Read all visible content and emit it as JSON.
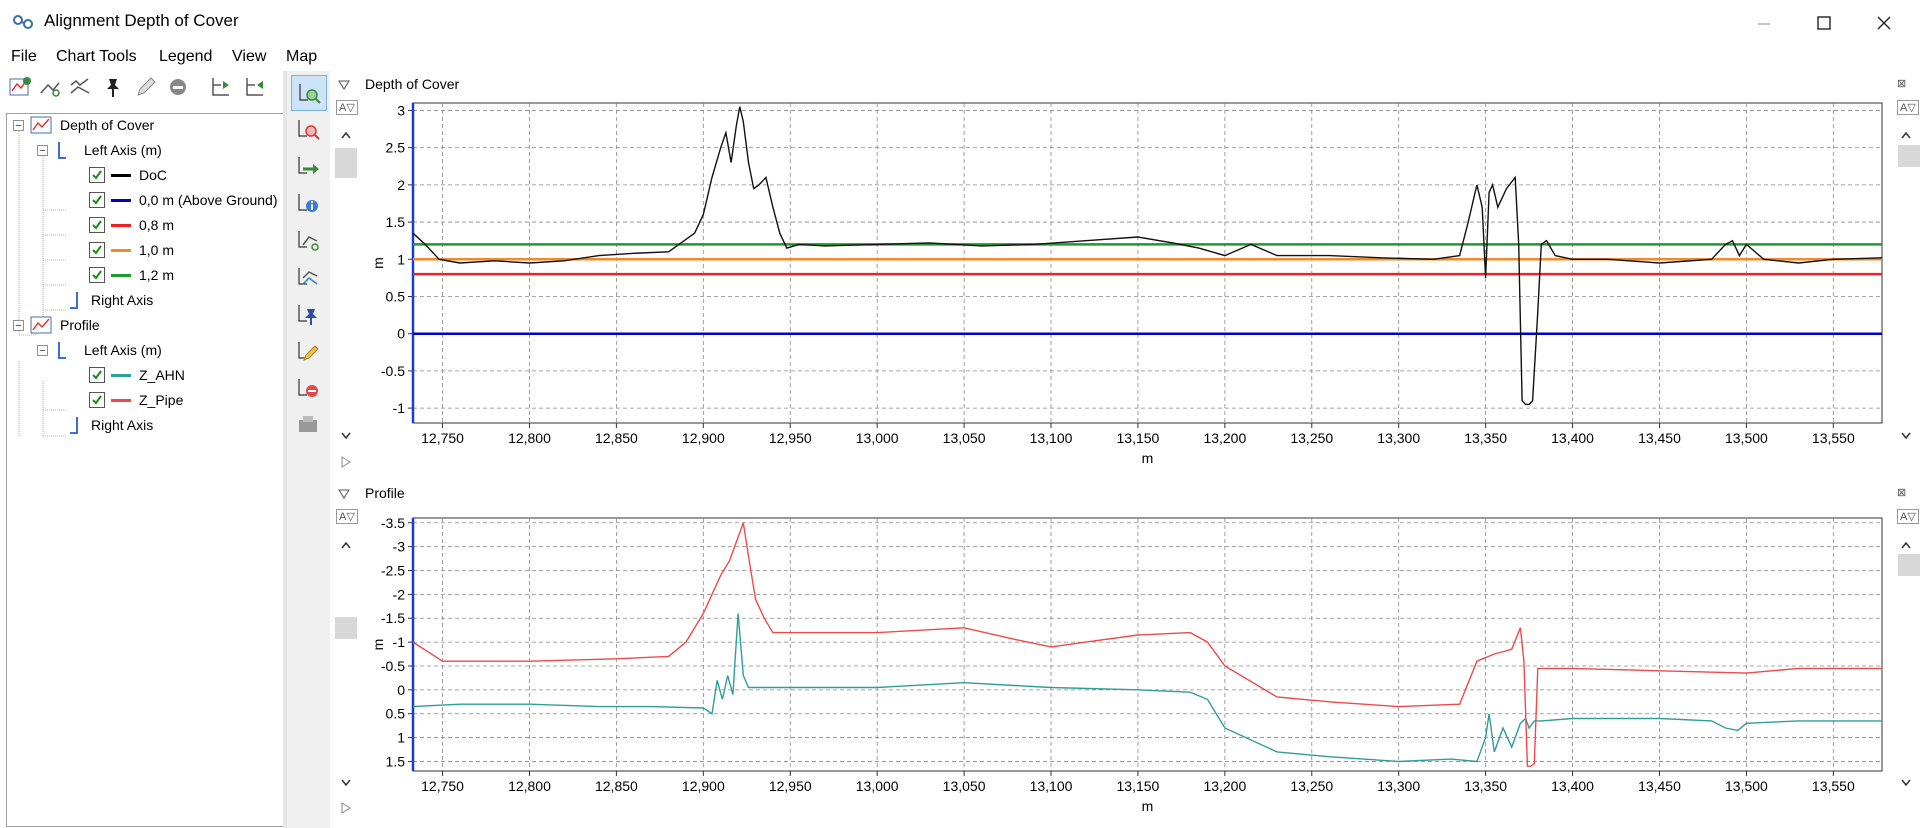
{
  "window": {
    "title": "Alignment Depth of Cover"
  },
  "menu": [
    "File",
    "Chart Tools",
    "Legend",
    "View",
    "Map"
  ],
  "tree": [
    {
      "label": "Depth of Cover",
      "level": 0
    },
    {
      "label": "Left Axis (m)",
      "level": 1
    },
    {
      "label": "DoC",
      "level": 2,
      "checked": true,
      "color": "#000000"
    },
    {
      "label": "0,0 m (Above Ground)",
      "level": 2,
      "checked": true,
      "color": "#0000cc"
    },
    {
      "label": "0,8 m",
      "level": 2,
      "checked": true,
      "color": "#ee2222"
    },
    {
      "label": "1,0 m",
      "level": 2,
      "checked": true,
      "color": "#f08a2a"
    },
    {
      "label": "1,2 m",
      "level": 2,
      "checked": true,
      "color": "#1e9a2a"
    },
    {
      "label": "Right Axis",
      "level": 1
    },
    {
      "label": "Profile",
      "level": 0
    },
    {
      "label": "Left Axis (m)",
      "level": 1
    },
    {
      "label": "Z_AHN",
      "level": 2,
      "checked": true,
      "color": "#2e9e9a"
    },
    {
      "label": "Z_Pipe",
      "level": 2,
      "checked": true,
      "color": "#ee4a4a"
    },
    {
      "label": "Right Axis",
      "level": 1
    }
  ],
  "charts": {
    "doc": {
      "title": "Depth of Cover",
      "ylabel": "m",
      "xlabel": "m",
      "resize_label": "A▽"
    },
    "profile": {
      "title": "Profile",
      "ylabel": "m",
      "xlabel": "m",
      "resize_label": "A▽"
    }
  },
  "chart_data": [
    {
      "type": "line",
      "title": "Depth of Cover",
      "xlabel": "m",
      "ylabel": "m",
      "xlim": [
        12733,
        13578
      ],
      "ylim": [
        3.1,
        -1.2
      ],
      "y_inverted": true,
      "xticks": [
        "12,750",
        "12,800",
        "12,850",
        "12,900",
        "12,950",
        "13,000",
        "13,050",
        "13,100",
        "13,150",
        "13,200",
        "13,250",
        "13,300",
        "13,350",
        "13,400",
        "13,450",
        "13,500",
        "13,550"
      ],
      "yticks": [
        "-1",
        "-0.5",
        "0",
        "0.5",
        "1",
        "1.5",
        "2",
        "2.5",
        "3"
      ],
      "grid": true,
      "hlines": [
        {
          "name": "0,0 m (Above Ground)",
          "value": 0.0,
          "color": "#0000cc"
        },
        {
          "name": "0,8 m",
          "value": 0.8,
          "color": "#ee2222"
        },
        {
          "name": "1,0 m",
          "value": 1.0,
          "color": "#f08a2a"
        },
        {
          "name": "1,2 m",
          "value": 1.2,
          "color": "#1e9a2a"
        }
      ],
      "series": [
        {
          "name": "DoC",
          "color": "#111111",
          "x": [
            12733,
            12740,
            12748,
            12760,
            12780,
            12800,
            12820,
            12840,
            12860,
            12880,
            12895,
            12900,
            12905,
            12910,
            12913,
            12916,
            12919,
            12921,
            12923,
            12926,
            12929,
            12932,
            12936,
            12940,
            12944,
            12948,
            12955,
            12970,
            13000,
            13030,
            13060,
            13090,
            13120,
            13150,
            13170,
            13185,
            13200,
            13215,
            13230,
            13260,
            13290,
            13320,
            13335,
            13340,
            13345,
            13348,
            13350,
            13352,
            13354,
            13357,
            13362,
            13367,
            13369,
            13371,
            13373,
            13375,
            13377,
            13380,
            13382,
            13385,
            13390,
            13400,
            13420,
            13450,
            13480,
            13488,
            13492,
            13496,
            13500,
            13510,
            13530,
            13550,
            13578
          ],
          "y": [
            1.35,
            1.2,
            1.0,
            0.95,
            0.98,
            0.95,
            0.98,
            1.05,
            1.08,
            1.1,
            1.35,
            1.6,
            2.1,
            2.5,
            2.7,
            2.3,
            2.8,
            3.05,
            2.85,
            2.3,
            1.95,
            2.0,
            2.1,
            1.7,
            1.35,
            1.15,
            1.2,
            1.18,
            1.2,
            1.22,
            1.18,
            1.2,
            1.25,
            1.3,
            1.22,
            1.15,
            1.05,
            1.2,
            1.05,
            1.05,
            1.02,
            1.0,
            1.05,
            1.5,
            2.0,
            1.7,
            0.75,
            1.9,
            2.0,
            1.7,
            1.95,
            2.1,
            1.2,
            -0.9,
            -0.95,
            -0.95,
            -0.9,
            0.3,
            1.2,
            1.25,
            1.05,
            1.0,
            1.0,
            0.95,
            1.0,
            1.2,
            1.25,
            1.05,
            1.2,
            1.0,
            0.95,
            1.0,
            1.02
          ]
        }
      ]
    },
    {
      "type": "line",
      "title": "Profile",
      "xlabel": "m",
      "ylabel": "m",
      "xlim": [
        12733,
        13578
      ],
      "ylim": [
        -3.6,
        1.7
      ],
      "xticks": [
        "12,750",
        "12,800",
        "12,850",
        "12,900",
        "12,950",
        "13,000",
        "13,050",
        "13,100",
        "13,150",
        "13,200",
        "13,250",
        "13,300",
        "13,350",
        "13,400",
        "13,450",
        "13,500",
        "13,550"
      ],
      "yticks": [
        "1.5",
        "1",
        "0.5",
        "0",
        "-0.5",
        "-1",
        "-1.5",
        "-2",
        "-2.5",
        "-3",
        "-3.5"
      ],
      "grid": true,
      "series": [
        {
          "name": "Z_AHN",
          "color": "#2e9e9a",
          "x": [
            12733,
            12760,
            12800,
            12840,
            12870,
            12900,
            12905,
            12908,
            12911,
            12914,
            12917,
            12920,
            12923,
            12926,
            12930,
            12940,
            12960,
            13000,
            13050,
            13100,
            13150,
            13180,
            13190,
            13200,
            13230,
            13260,
            13300,
            13330,
            13345,
            13350,
            13352,
            13355,
            13360,
            13365,
            13370,
            13373,
            13375,
            13378,
            13382,
            13400,
            13450,
            13480,
            13488,
            13495,
            13500,
            13530,
            13578
          ],
          "y": [
            0.35,
            0.3,
            0.3,
            0.35,
            0.35,
            0.38,
            0.5,
            -0.2,
            0.2,
            -0.3,
            0.1,
            -1.6,
            -0.3,
            -0.05,
            -0.05,
            -0.05,
            -0.05,
            -0.05,
            -0.15,
            -0.05,
            0.0,
            0.05,
            0.2,
            0.8,
            1.3,
            1.4,
            1.5,
            1.45,
            1.5,
            1.0,
            0.5,
            1.3,
            0.8,
            1.2,
            0.7,
            0.6,
            0.8,
            0.65,
            0.65,
            0.6,
            0.6,
            0.65,
            0.8,
            0.85,
            0.7,
            0.65,
            0.65
          ]
        },
        {
          "name": "Z_Pipe",
          "color": "#ee4a4a",
          "x": [
            12733,
            12750,
            12800,
            12850,
            12880,
            12890,
            12900,
            12910,
            12915,
            12920,
            12923,
            12926,
            12930,
            12935,
            12940,
            12960,
            13000,
            13050,
            13080,
            13100,
            13120,
            13150,
            13180,
            13190,
            13200,
            13230,
            13260,
            13300,
            13335,
            13345,
            13355,
            13365,
            13370,
            13372,
            13374,
            13376,
            13378,
            13380,
            13400,
            13450,
            13500,
            13530,
            13578
          ],
          "y": [
            -1.0,
            -0.6,
            -0.6,
            -0.65,
            -0.7,
            -1.0,
            -1.6,
            -2.4,
            -2.7,
            -3.2,
            -3.5,
            -2.8,
            -1.9,
            -1.5,
            -1.2,
            -1.2,
            -1.2,
            -1.3,
            -1.05,
            -0.9,
            -1.0,
            -1.15,
            -1.2,
            -1.0,
            -0.5,
            0.15,
            0.25,
            0.35,
            0.3,
            -0.6,
            -0.75,
            -0.85,
            -1.3,
            -0.6,
            1.6,
            1.6,
            1.55,
            -0.45,
            -0.45,
            -0.4,
            -0.35,
            -0.45,
            -0.45
          ]
        }
      ]
    }
  ]
}
